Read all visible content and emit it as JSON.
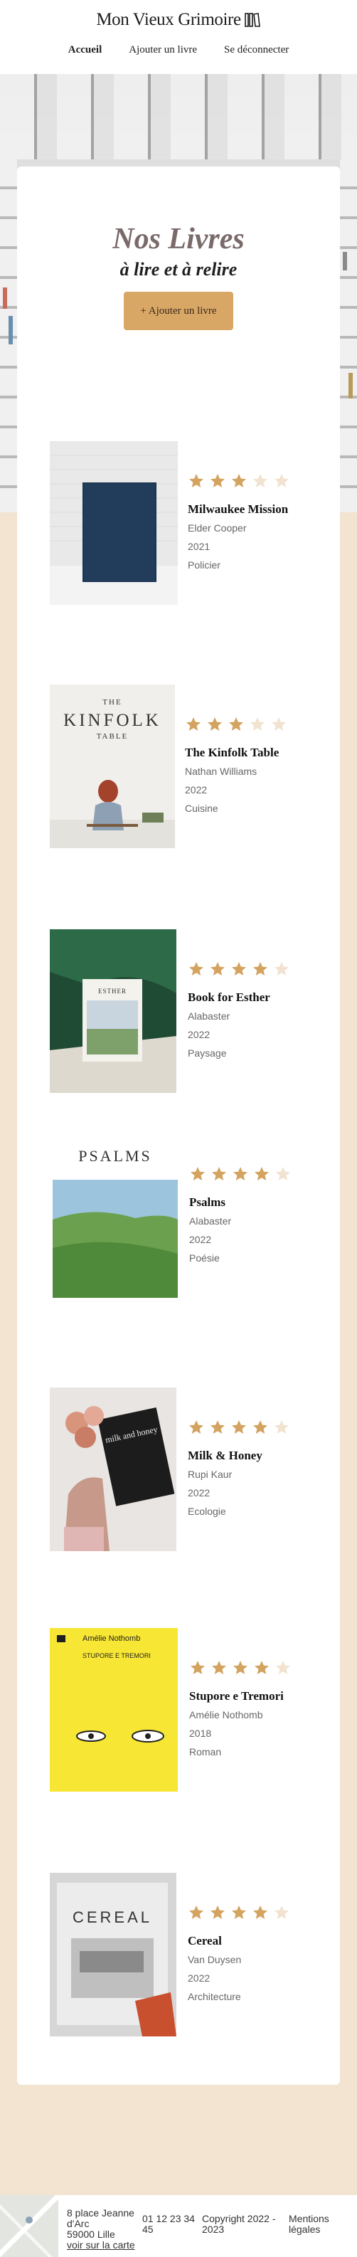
{
  "brand": {
    "name": "Mon Vieux Grimoire"
  },
  "nav": {
    "items": [
      {
        "label": "Accueil",
        "active": true
      },
      {
        "label": "Ajouter un livre",
        "active": false
      },
      {
        "label": "Se déconnecter",
        "active": false
      }
    ]
  },
  "main": {
    "title": "Nos Livres",
    "subtitle": "à lire et à relire",
    "add_button": "+ Ajouter un livre"
  },
  "books": [
    {
      "title": "Milwaukee Mission",
      "author": "Elder Cooper",
      "year": "2021",
      "genre": "Policier",
      "rating": 3,
      "cover": "blue-notebook"
    },
    {
      "title": "The Kinfolk Table",
      "author": "Nathan Williams",
      "year": "2022",
      "genre": "Cuisine",
      "rating": 3,
      "cover": "kinfolk"
    },
    {
      "title": "Book for Esther",
      "author": "Alabaster",
      "year": "2022",
      "genre": "Paysage",
      "rating": 4,
      "cover": "esther"
    },
    {
      "title": "Psalms",
      "author": "Alabaster",
      "year": "2022",
      "genre": "Poésie",
      "rating": 4,
      "cover": "psalms"
    },
    {
      "title": "Milk & Honey",
      "author": "Rupi Kaur",
      "year": "2022",
      "genre": "Ecologie",
      "rating": 4,
      "cover": "milk-honey"
    },
    {
      "title": "Stupore e Tremori",
      "author": "Amélie Nothomb",
      "year": "2018",
      "genre": "Roman",
      "rating": 4,
      "cover": "stupore"
    },
    {
      "title": "Cereal",
      "author": "Van Duysen",
      "year": "2022",
      "genre": "Architecture",
      "rating": 4,
      "cover": "cereal"
    }
  ],
  "covers": {
    "kinfolk": {
      "line1": "THE",
      "line2": "KINFOLK",
      "line3": "TABLE"
    },
    "esther": {
      "label": "ESTHER"
    },
    "psalms": {
      "label": "PSALMS"
    },
    "milk_honey": {
      "label": "milk and honey"
    },
    "stupore": {
      "author": "Amélie Nothomb",
      "title": "STUPORE E TREMORI"
    },
    "cereal": {
      "label": "CEREAL"
    }
  },
  "footer": {
    "address_line1": "8 place Jeanne",
    "address_line2": "d'Arc",
    "address_line3": "59000 Lille",
    "map_link": "voir sur la carte",
    "phone": "01 12 23 34 45",
    "copyright": "Copyright 2022 - 2023",
    "legal": "Mentions légales"
  },
  "colors": {
    "accent": "#d8a766",
    "star_on": "#d3a35f",
    "star_off": "#f1e3d0",
    "background": "#f3e3d1"
  }
}
